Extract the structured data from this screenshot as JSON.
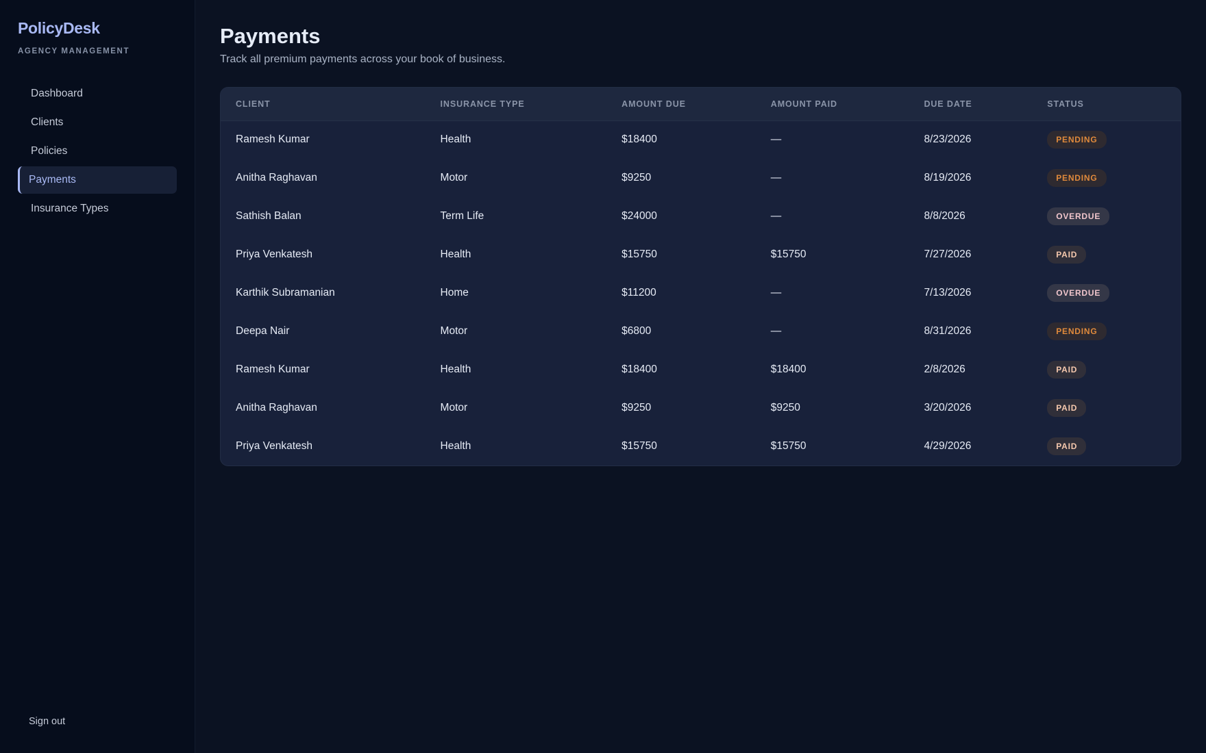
{
  "app": {
    "brand": "PolicyDesk",
    "brand_sub": "AGENCY MANAGEMENT"
  },
  "sidebar": {
    "items": [
      {
        "label": "Dashboard"
      },
      {
        "label": "Clients"
      },
      {
        "label": "Policies"
      },
      {
        "label": "Payments",
        "active": true
      },
      {
        "label": "Insurance Types"
      }
    ],
    "signout": "Sign out"
  },
  "page": {
    "title": "Payments",
    "subtitle": "Track all premium payments across your book of business."
  },
  "table": {
    "headers": [
      "CLIENT",
      "INSURANCE TYPE",
      "AMOUNT DUE",
      "AMOUNT PAID",
      "DUE DATE",
      "STATUS"
    ],
    "rows": [
      {
        "client": "Ramesh Kumar",
        "type": "Health",
        "due": "$18400",
        "paid": "—",
        "date": "8/23/2026",
        "status": "PENDING"
      },
      {
        "client": "Anitha Raghavan",
        "type": "Motor",
        "due": "$9250",
        "paid": "—",
        "date": "8/19/2026",
        "status": "PENDING"
      },
      {
        "client": "Sathish Balan",
        "type": "Term Life",
        "due": "$24000",
        "paid": "—",
        "date": "8/8/2026",
        "status": "OVERDUE"
      },
      {
        "client": "Priya Venkatesh",
        "type": "Health",
        "due": "$15750",
        "paid": "$15750",
        "date": "7/27/2026",
        "status": "PAID"
      },
      {
        "client": "Karthik Subramanian",
        "type": "Home",
        "due": "$11200",
        "paid": "—",
        "date": "7/13/2026",
        "status": "OVERDUE"
      },
      {
        "client": "Deepa Nair",
        "type": "Motor",
        "due": "$6800",
        "paid": "—",
        "date": "8/31/2026",
        "status": "PENDING"
      },
      {
        "client": "Ramesh Kumar",
        "type": "Health",
        "due": "$18400",
        "paid": "$18400",
        "date": "2/8/2026",
        "status": "PAID"
      },
      {
        "client": "Anitha Raghavan",
        "type": "Motor",
        "due": "$9250",
        "paid": "$9250",
        "date": "3/20/2026",
        "status": "PAID"
      },
      {
        "client": "Priya Venkatesh",
        "type": "Health",
        "due": "$15750",
        "paid": "$15750",
        "date": "4/29/2026",
        "status": "PAID"
      }
    ]
  },
  "colors": {
    "background": "#0b1222",
    "sidebar": "#060d1c",
    "accent": "#a9b9f4",
    "pending": "#e08a3c",
    "overdue": "#f1c6cc",
    "paid": "#f5c8ad"
  }
}
